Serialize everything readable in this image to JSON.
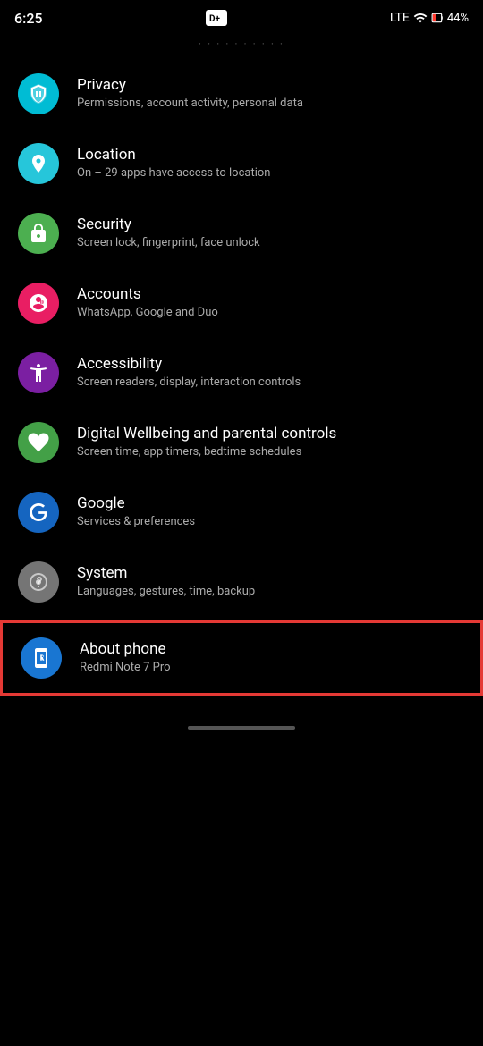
{
  "statusBar": {
    "time": "6:25",
    "lte": "LTE",
    "battery": "44%",
    "batteryColor": "#ff3b30"
  },
  "topPartial": {
    "text": "·····  ·  ·····  ·  ·····"
  },
  "settingsItems": [
    {
      "id": "privacy",
      "title": "Privacy",
      "subtitle": "Permissions, account activity, personal data",
      "iconColor": "#00BCD4",
      "iconType": "privacy"
    },
    {
      "id": "location",
      "title": "Location",
      "subtitle": "On – 29 apps have access to location",
      "iconColor": "#26C6DA",
      "iconType": "location"
    },
    {
      "id": "security",
      "title": "Security",
      "subtitle": "Screen lock, fingerprint, face unlock",
      "iconColor": "#4CAF50",
      "iconType": "security"
    },
    {
      "id": "accounts",
      "title": "Accounts",
      "subtitle": "WhatsApp, Google and Duo",
      "iconColor": "#E91E63",
      "iconType": "accounts"
    },
    {
      "id": "accessibility",
      "title": "Accessibility",
      "subtitle": "Screen readers, display, interaction controls",
      "iconColor": "#7B1FA2",
      "iconType": "accessibility"
    },
    {
      "id": "digital-wellbeing",
      "title": "Digital Wellbeing and parental controls",
      "subtitle": "Screen time, app timers, bedtime schedules",
      "iconColor": "#43A047",
      "iconType": "wellbeing"
    },
    {
      "id": "google",
      "title": "Google",
      "subtitle": "Services & preferences",
      "iconColor": "#1565C0",
      "iconType": "google"
    },
    {
      "id": "system",
      "title": "System",
      "subtitle": "Languages, gestures, time, backup",
      "iconColor": "#757575",
      "iconType": "system"
    },
    {
      "id": "about-phone",
      "title": "About phone",
      "subtitle": "Redmi Note 7 Pro",
      "iconColor": "#1976D2",
      "iconType": "about",
      "highlighted": true
    }
  ]
}
